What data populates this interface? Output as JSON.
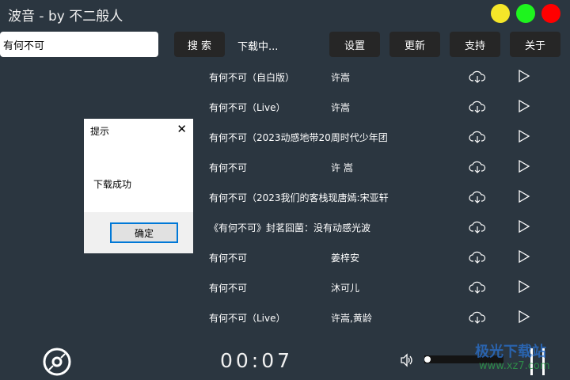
{
  "window": {
    "title": "波音 - by 不二般人",
    "controls": [
      {
        "name": "minimize",
        "color": "#f5e629"
      },
      {
        "name": "maximize",
        "color": "#1ef41e"
      },
      {
        "name": "close",
        "color": "#ff0000"
      }
    ]
  },
  "toolbar": {
    "search_value": "有何不可",
    "search_label": "搜 索",
    "status": "下载中...",
    "settings": "设置",
    "update": "更新",
    "support": "支持",
    "about": "关于"
  },
  "songs": [
    {
      "title": "有何不可（自白版）",
      "artist": "许嵩"
    },
    {
      "title": "有何不可（Live）",
      "artist": "许嵩"
    },
    {
      "title": "有何不可（2023动感地带20周时代少年团",
      "artist": ""
    },
    {
      "title": "有何不可",
      "artist": "许 嵩"
    },
    {
      "title": "有何不可（2023我们的客栈现唐嫣:宋亚轩",
      "artist": ""
    },
    {
      "title": "《有何不可》封茗囧菌：没有动感光波",
      "artist": ""
    },
    {
      "title": "有何不可",
      "artist": "姜梓安"
    },
    {
      "title": "有何不可",
      "artist": "沐可儿"
    },
    {
      "title": "有何不可（Live）",
      "artist": "许嵩,黄龄"
    }
  ],
  "dialog": {
    "title": "提示",
    "message": "下载成功",
    "ok": "确定"
  },
  "player": {
    "time": "00:07",
    "volume_percent": 0
  },
  "watermark": {
    "text": "极光下载站",
    "url_text": "www.xz7.com"
  }
}
